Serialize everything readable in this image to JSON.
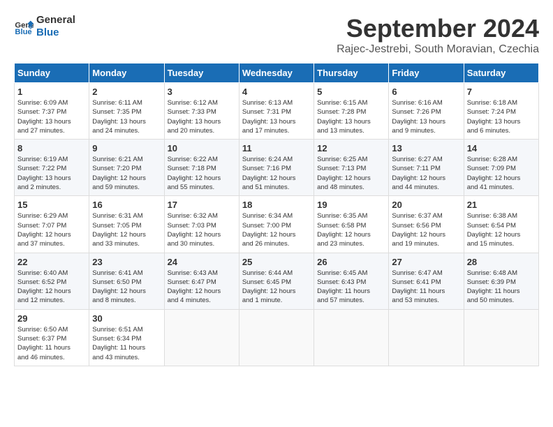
{
  "logo": {
    "line1": "General",
    "line2": "Blue"
  },
  "title": "September 2024",
  "subtitle": "Rajec-Jestrebi, South Moravian, Czechia",
  "header_days": [
    "Sunday",
    "Monday",
    "Tuesday",
    "Wednesday",
    "Thursday",
    "Friday",
    "Saturday"
  ],
  "weeks": [
    [
      {
        "day": "1",
        "info": "Sunrise: 6:09 AM\nSunset: 7:37 PM\nDaylight: 13 hours\nand 27 minutes."
      },
      {
        "day": "2",
        "info": "Sunrise: 6:11 AM\nSunset: 7:35 PM\nDaylight: 13 hours\nand 24 minutes."
      },
      {
        "day": "3",
        "info": "Sunrise: 6:12 AM\nSunset: 7:33 PM\nDaylight: 13 hours\nand 20 minutes."
      },
      {
        "day": "4",
        "info": "Sunrise: 6:13 AM\nSunset: 7:31 PM\nDaylight: 13 hours\nand 17 minutes."
      },
      {
        "day": "5",
        "info": "Sunrise: 6:15 AM\nSunset: 7:28 PM\nDaylight: 13 hours\nand 13 minutes."
      },
      {
        "day": "6",
        "info": "Sunrise: 6:16 AM\nSunset: 7:26 PM\nDaylight: 13 hours\nand 9 minutes."
      },
      {
        "day": "7",
        "info": "Sunrise: 6:18 AM\nSunset: 7:24 PM\nDaylight: 13 hours\nand 6 minutes."
      }
    ],
    [
      {
        "day": "8",
        "info": "Sunrise: 6:19 AM\nSunset: 7:22 PM\nDaylight: 13 hours\nand 2 minutes."
      },
      {
        "day": "9",
        "info": "Sunrise: 6:21 AM\nSunset: 7:20 PM\nDaylight: 12 hours\nand 59 minutes."
      },
      {
        "day": "10",
        "info": "Sunrise: 6:22 AM\nSunset: 7:18 PM\nDaylight: 12 hours\nand 55 minutes."
      },
      {
        "day": "11",
        "info": "Sunrise: 6:24 AM\nSunset: 7:16 PM\nDaylight: 12 hours\nand 51 minutes."
      },
      {
        "day": "12",
        "info": "Sunrise: 6:25 AM\nSunset: 7:13 PM\nDaylight: 12 hours\nand 48 minutes."
      },
      {
        "day": "13",
        "info": "Sunrise: 6:27 AM\nSunset: 7:11 PM\nDaylight: 12 hours\nand 44 minutes."
      },
      {
        "day": "14",
        "info": "Sunrise: 6:28 AM\nSunset: 7:09 PM\nDaylight: 12 hours\nand 41 minutes."
      }
    ],
    [
      {
        "day": "15",
        "info": "Sunrise: 6:29 AM\nSunset: 7:07 PM\nDaylight: 12 hours\nand 37 minutes."
      },
      {
        "day": "16",
        "info": "Sunrise: 6:31 AM\nSunset: 7:05 PM\nDaylight: 12 hours\nand 33 minutes."
      },
      {
        "day": "17",
        "info": "Sunrise: 6:32 AM\nSunset: 7:03 PM\nDaylight: 12 hours\nand 30 minutes."
      },
      {
        "day": "18",
        "info": "Sunrise: 6:34 AM\nSunset: 7:00 PM\nDaylight: 12 hours\nand 26 minutes."
      },
      {
        "day": "19",
        "info": "Sunrise: 6:35 AM\nSunset: 6:58 PM\nDaylight: 12 hours\nand 23 minutes."
      },
      {
        "day": "20",
        "info": "Sunrise: 6:37 AM\nSunset: 6:56 PM\nDaylight: 12 hours\nand 19 minutes."
      },
      {
        "day": "21",
        "info": "Sunrise: 6:38 AM\nSunset: 6:54 PM\nDaylight: 12 hours\nand 15 minutes."
      }
    ],
    [
      {
        "day": "22",
        "info": "Sunrise: 6:40 AM\nSunset: 6:52 PM\nDaylight: 12 hours\nand 12 minutes."
      },
      {
        "day": "23",
        "info": "Sunrise: 6:41 AM\nSunset: 6:50 PM\nDaylight: 12 hours\nand 8 minutes."
      },
      {
        "day": "24",
        "info": "Sunrise: 6:43 AM\nSunset: 6:47 PM\nDaylight: 12 hours\nand 4 minutes."
      },
      {
        "day": "25",
        "info": "Sunrise: 6:44 AM\nSunset: 6:45 PM\nDaylight: 12 hours\nand 1 minute."
      },
      {
        "day": "26",
        "info": "Sunrise: 6:45 AM\nSunset: 6:43 PM\nDaylight: 11 hours\nand 57 minutes."
      },
      {
        "day": "27",
        "info": "Sunrise: 6:47 AM\nSunset: 6:41 PM\nDaylight: 11 hours\nand 53 minutes."
      },
      {
        "day": "28",
        "info": "Sunrise: 6:48 AM\nSunset: 6:39 PM\nDaylight: 11 hours\nand 50 minutes."
      }
    ],
    [
      {
        "day": "29",
        "info": "Sunrise: 6:50 AM\nSunset: 6:37 PM\nDaylight: 11 hours\nand 46 minutes."
      },
      {
        "day": "30",
        "info": "Sunrise: 6:51 AM\nSunset: 6:34 PM\nDaylight: 11 hours\nand 43 minutes."
      },
      {
        "day": "",
        "info": ""
      },
      {
        "day": "",
        "info": ""
      },
      {
        "day": "",
        "info": ""
      },
      {
        "day": "",
        "info": ""
      },
      {
        "day": "",
        "info": ""
      }
    ]
  ]
}
